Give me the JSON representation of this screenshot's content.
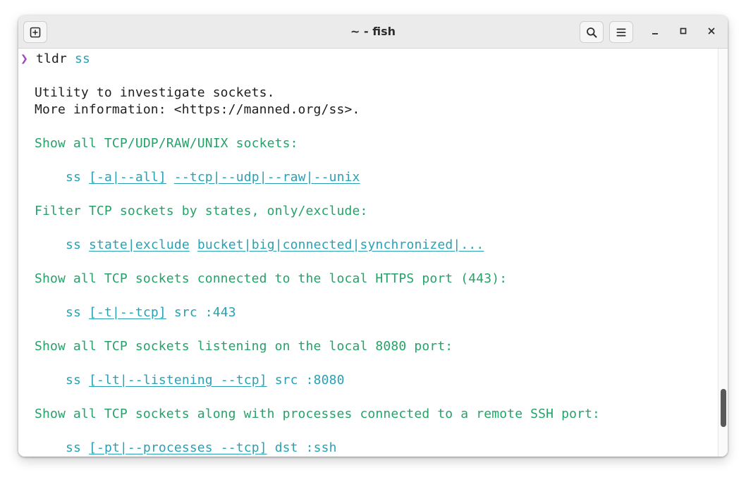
{
  "window": {
    "title": "~ - fish"
  },
  "terminal": {
    "prompt_glyph": "❯",
    "command": "tldr",
    "command_arg": "ss",
    "description": "Utility to investigate sockets.",
    "more_info": "More information: <https://manned.org/ss>.",
    "examples": [
      {
        "description": "Show all TCP/UDP/RAW/UNIX sockets:",
        "cmd": "ss",
        "parts": [
          "[-a|--all]",
          "--tcp|--udp|--raw|--unix"
        ],
        "tail": ""
      },
      {
        "description": "Filter TCP sockets by states, only/exclude:",
        "cmd": "ss",
        "parts": [
          "state|exclude",
          "bucket|big|connected|synchronized|..."
        ],
        "tail": ""
      },
      {
        "description": "Show all TCP sockets connected to the local HTTPS port (443):",
        "cmd": "ss",
        "parts": [
          "[-t|--tcp]"
        ],
        "tail": "src :443"
      },
      {
        "description": "Show all TCP sockets listening on the local 8080 port:",
        "cmd": "ss",
        "parts": [
          "[-lt|--listening --tcp]"
        ],
        "tail": "src :8080"
      },
      {
        "description": "Show all TCP sockets along with processes connected to a remote SSH port:",
        "cmd": "ss",
        "parts": [
          "[-pt|--processes --tcp]"
        ],
        "tail": "dst :ssh"
      }
    ]
  },
  "colors": {
    "prompt": "#a347ba",
    "description_green": "#26a269",
    "code_cyan": "#2aa1b3",
    "text": "#1e1e1e"
  },
  "icons": {
    "new_tab": "new-tab-icon",
    "search": "search-icon",
    "menu": "hamburger-menu-icon",
    "minimize": "minimize-icon",
    "maximize": "maximize-icon",
    "close": "close-icon"
  }
}
